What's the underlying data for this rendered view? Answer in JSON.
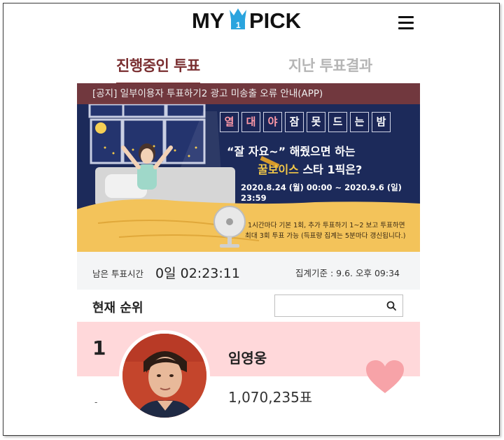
{
  "header": {
    "logo_text_left": "MY",
    "logo_text_right": "PICK",
    "logo_badge": "1"
  },
  "tabs": [
    {
      "label": "진행중인 투표",
      "active": true
    },
    {
      "label": "지난 투표결과",
      "active": false
    }
  ],
  "banner": {
    "notice": "[공지] 일부이용자 투표하기2 광고 미송출 오류 안내(APP)",
    "title_chars": [
      "열",
      "대",
      "야",
      "잠",
      "못",
      "드",
      "는",
      "밤"
    ],
    "subtitle_line1": "“잘 자요~” 해줬으면 하는",
    "subtitle_line2_highlight": "꿀보이스",
    "subtitle_line2_rest": " 스타 1픽은?",
    "date_range": "2020.8.24 (월) 00:00 ~ 2020.9.6 (일) 23:59",
    "info_line1": "1시간마다 기본 1회, 추가 투표하기 1~2 보고 투표하면",
    "info_line2": "최대 3회 투표 가능 (득표량 집계는 5분마다 갱신됩니다.)"
  },
  "status": {
    "remaining_label": "남은 투표시간",
    "remaining_days": "0일",
    "remaining_time": "02:23:11",
    "basis_label": "집계기준 : 9.6. 오후 09:34"
  },
  "ranking": {
    "title": "현재 순위",
    "search_placeholder": "",
    "items": [
      {
        "rank": "1",
        "change": "-",
        "name": "임영웅",
        "votes": "1,070,235표"
      }
    ]
  },
  "colors": {
    "accent": "#7a2f31",
    "card_bg": "#ffd8da",
    "heart": "#f7a3a8",
    "banner_bg": "#1c2a5a"
  }
}
